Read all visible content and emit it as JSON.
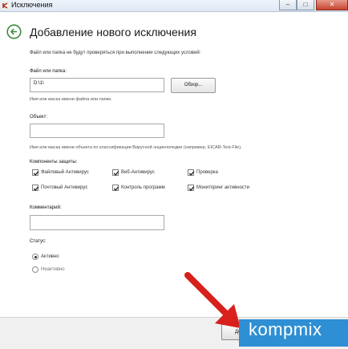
{
  "window": {
    "title": "Исключения",
    "minimize_label": "–",
    "maximize_label": "□",
    "close_label": "✕"
  },
  "header": {
    "title": "Добавление нового исключения",
    "back_icon": "back-arrow-icon"
  },
  "intro_text": "Файл или папка не будут проверяться при выполнении следующих условий:",
  "file": {
    "label": "Файл или папка:",
    "value": "D:\\1\\",
    "browse_label": "Обзор...",
    "hint": "Имя или маска имени файла или папки."
  },
  "object": {
    "label": "Объект:",
    "value": "",
    "hint": "Имя или маска имени объекта по классификации Вирусной энциклопедии (например, EICAR-Test-File)."
  },
  "components": {
    "label": "Компоненты защиты:",
    "items": [
      {
        "label": "Файловый Антивирус",
        "checked": true
      },
      {
        "label": "Веб-Антивирус",
        "checked": true
      },
      {
        "label": "Проверка",
        "checked": true
      },
      {
        "label": "Почтовый Антивирус",
        "checked": true
      },
      {
        "label": "Контроль программ",
        "checked": true
      },
      {
        "label": "Мониторинг активности",
        "checked": true
      }
    ]
  },
  "comment": {
    "label": "Комментарий:",
    "value": ""
  },
  "status": {
    "label": "Статус:",
    "options": [
      {
        "label": "Активно",
        "selected": true
      },
      {
        "label": "Неактивно",
        "selected": false
      }
    ]
  },
  "footer": {
    "add_label": "До"
  },
  "watermark": {
    "text": "kompmix"
  },
  "colors": {
    "accent_green": "#3f8a3f",
    "watermark_blue": "#2e8fd4",
    "arrow_red": "#d8201c"
  }
}
